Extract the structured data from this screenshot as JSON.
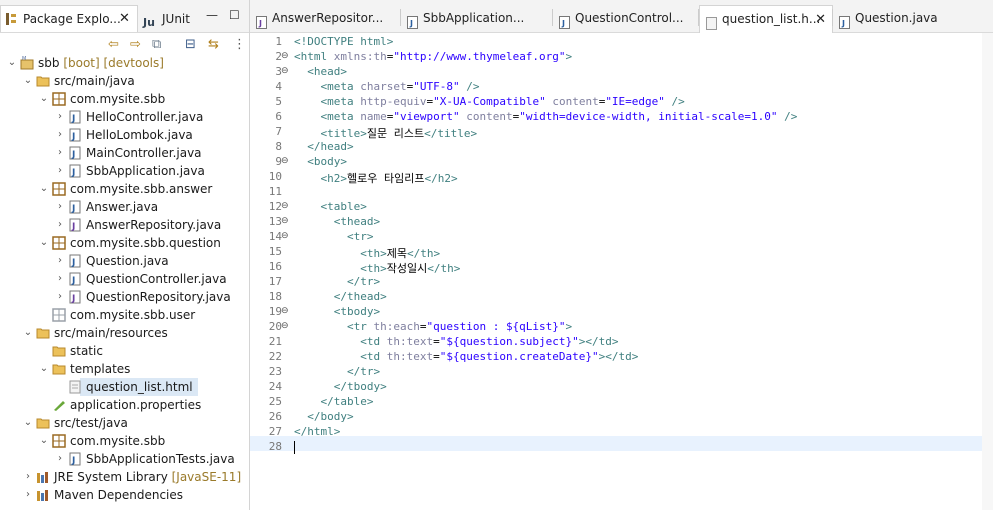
{
  "left_panel": {
    "tabs": [
      {
        "label": "Package Explo...",
        "active": true
      },
      {
        "label": "JUnit",
        "active": false
      }
    ],
    "tree": [
      {
        "label": "sbb",
        "decoration": " [boot] [devtools]",
        "level": 0,
        "expanded": true,
        "icon": "project-icon"
      },
      {
        "label": "src/main/java",
        "level": 1,
        "expanded": true,
        "icon": "source-folder-icon"
      },
      {
        "label": "com.mysite.sbb",
        "level": 2,
        "expanded": true,
        "icon": "package-icon"
      },
      {
        "label": "HelloController.java",
        "level": 3,
        "expanded": false,
        "icon": "java-file-icon"
      },
      {
        "label": "HelloLombok.java",
        "level": 3,
        "expanded": false,
        "icon": "java-file-icon"
      },
      {
        "label": "MainController.java",
        "level": 3,
        "expanded": false,
        "icon": "java-file-icon"
      },
      {
        "label": "SbbApplication.java",
        "level": 3,
        "expanded": false,
        "icon": "java-file-icon"
      },
      {
        "label": "com.mysite.sbb.answer",
        "level": 2,
        "expanded": true,
        "icon": "package-icon"
      },
      {
        "label": "Answer.java",
        "level": 3,
        "expanded": false,
        "icon": "java-file-icon"
      },
      {
        "label": "AnswerRepository.java",
        "level": 3,
        "expanded": false,
        "icon": "java-interface-icon"
      },
      {
        "label": "com.mysite.sbb.question",
        "level": 2,
        "expanded": true,
        "icon": "package-icon"
      },
      {
        "label": "Question.java",
        "level": 3,
        "expanded": false,
        "icon": "java-file-icon"
      },
      {
        "label": "QuestionController.java",
        "level": 3,
        "expanded": false,
        "icon": "java-file-icon"
      },
      {
        "label": "QuestionRepository.java",
        "level": 3,
        "expanded": false,
        "icon": "java-interface-icon"
      },
      {
        "label": "com.mysite.sbb.user",
        "level": 2,
        "expanded": null,
        "icon": "package-empty-icon"
      },
      {
        "label": "src/main/resources",
        "level": 1,
        "expanded": true,
        "icon": "source-folder-icon"
      },
      {
        "label": "static",
        "level": 2,
        "expanded": null,
        "icon": "folder-icon"
      },
      {
        "label": "templates",
        "level": 2,
        "expanded": true,
        "icon": "folder-icon"
      },
      {
        "label": "question_list.html",
        "level": 3,
        "expanded": null,
        "icon": "html-file-icon",
        "selected": true
      },
      {
        "label": "application.properties",
        "level": 2,
        "expanded": null,
        "icon": "properties-file-icon"
      },
      {
        "label": "src/test/java",
        "level": 1,
        "expanded": true,
        "icon": "source-folder-icon"
      },
      {
        "label": "com.mysite.sbb",
        "level": 2,
        "expanded": true,
        "icon": "package-icon"
      },
      {
        "label": "SbbApplicationTests.java",
        "level": 3,
        "expanded": false,
        "icon": "java-file-icon"
      },
      {
        "label": "JRE System Library",
        "decoration": " [JavaSE-11]",
        "level": 1,
        "expanded": false,
        "icon": "library-icon"
      },
      {
        "label": "Maven Dependencies",
        "level": 1,
        "expanded": false,
        "icon": "library-icon"
      }
    ]
  },
  "editor": {
    "tabs": [
      {
        "label": "AnswerRepositor...",
        "icon": "java-interface-icon",
        "active": false
      },
      {
        "label": "SbbApplication...",
        "icon": "java-file-icon",
        "active": false
      },
      {
        "label": "QuestionControl...",
        "icon": "java-file-icon",
        "active": false
      },
      {
        "label": "question_list.h...",
        "icon": "html-file-icon",
        "active": true
      },
      {
        "label": "Question.java",
        "icon": "java-file-icon",
        "active": false
      }
    ],
    "lines": [
      {
        "n": "1",
        "fold": "",
        "parts": [
          [
            "tag",
            "<!DOCTYPE html>"
          ]
        ]
      },
      {
        "n": "2",
        "fold": "⊖",
        "parts": [
          [
            "tag",
            "<html "
          ],
          [
            "an",
            "xmlns:th"
          ],
          [
            "",
            "="
          ],
          [
            "av",
            "\"http://www.thymeleaf.org\""
          ],
          [
            "tag",
            ">"
          ]
        ]
      },
      {
        "n": "3",
        "fold": "⊖",
        "parts": [
          [
            "",
            "  "
          ],
          [
            "tag",
            "<head>"
          ]
        ]
      },
      {
        "n": "4",
        "fold": "",
        "parts": [
          [
            "",
            "    "
          ],
          [
            "tag",
            "<meta "
          ],
          [
            "an",
            "charset"
          ],
          [
            "",
            "="
          ],
          [
            "av",
            "\"UTF-8\""
          ],
          [
            "tag",
            " />"
          ]
        ]
      },
      {
        "n": "5",
        "fold": "",
        "parts": [
          [
            "",
            "    "
          ],
          [
            "tag",
            "<meta "
          ],
          [
            "an",
            "http-equiv"
          ],
          [
            "",
            "="
          ],
          [
            "av",
            "\"X-UA-Compatible\""
          ],
          [
            "",
            " "
          ],
          [
            "an",
            "content"
          ],
          [
            "",
            "="
          ],
          [
            "av",
            "\"IE=edge\""
          ],
          [
            "tag",
            " />"
          ]
        ]
      },
      {
        "n": "6",
        "fold": "",
        "parts": [
          [
            "",
            "    "
          ],
          [
            "tag",
            "<meta "
          ],
          [
            "an",
            "name"
          ],
          [
            "",
            "="
          ],
          [
            "av",
            "\"viewport\""
          ],
          [
            "",
            " "
          ],
          [
            "an",
            "content"
          ],
          [
            "",
            "="
          ],
          [
            "av",
            "\"width=device-width, initial-scale=1.0\""
          ],
          [
            "tag",
            " />"
          ]
        ]
      },
      {
        "n": "7",
        "fold": "",
        "parts": [
          [
            "",
            "    "
          ],
          [
            "tag",
            "<title>"
          ],
          [
            "",
            "질문 리스트"
          ],
          [
            "tag",
            "</title>"
          ]
        ]
      },
      {
        "n": "8",
        "fold": "",
        "parts": [
          [
            "",
            "  "
          ],
          [
            "tag",
            "</head>"
          ]
        ]
      },
      {
        "n": "9",
        "fold": "⊖",
        "parts": [
          [
            "",
            "  "
          ],
          [
            "tag",
            "<body>"
          ]
        ]
      },
      {
        "n": "10",
        "fold": "",
        "parts": [
          [
            "",
            "    "
          ],
          [
            "tag",
            "<h2>"
          ],
          [
            "",
            "헬로우 타임리프"
          ],
          [
            "tag",
            "</h2>"
          ]
        ]
      },
      {
        "n": "11",
        "fold": "",
        "parts": []
      },
      {
        "n": "12",
        "fold": "⊖",
        "parts": [
          [
            "",
            "    "
          ],
          [
            "tag",
            "<table>"
          ]
        ]
      },
      {
        "n": "13",
        "fold": "⊖",
        "parts": [
          [
            "",
            "      "
          ],
          [
            "tag",
            "<thead>"
          ]
        ]
      },
      {
        "n": "14",
        "fold": "⊖",
        "parts": [
          [
            "",
            "        "
          ],
          [
            "tag",
            "<tr>"
          ]
        ]
      },
      {
        "n": "15",
        "fold": "",
        "parts": [
          [
            "",
            "          "
          ],
          [
            "tag",
            "<th>"
          ],
          [
            "",
            "제목"
          ],
          [
            "tag",
            "</th>"
          ]
        ]
      },
      {
        "n": "16",
        "fold": "",
        "parts": [
          [
            "",
            "          "
          ],
          [
            "tag",
            "<th>"
          ],
          [
            "",
            "작성일시"
          ],
          [
            "tag",
            "</th>"
          ]
        ]
      },
      {
        "n": "17",
        "fold": "",
        "parts": [
          [
            "",
            "        "
          ],
          [
            "tag",
            "</tr>"
          ]
        ]
      },
      {
        "n": "18",
        "fold": "",
        "parts": [
          [
            "",
            "      "
          ],
          [
            "tag",
            "</thead>"
          ]
        ]
      },
      {
        "n": "19",
        "fold": "⊖",
        "parts": [
          [
            "",
            "      "
          ],
          [
            "tag",
            "<tbody>"
          ]
        ]
      },
      {
        "n": "20",
        "fold": "⊖",
        "parts": [
          [
            "",
            "        "
          ],
          [
            "tag",
            "<tr "
          ],
          [
            "an",
            "th:each"
          ],
          [
            "",
            "="
          ],
          [
            "av",
            "\"question : ${qList}\""
          ],
          [
            "tag",
            ">"
          ]
        ]
      },
      {
        "n": "21",
        "fold": "",
        "parts": [
          [
            "",
            "          "
          ],
          [
            "tag",
            "<td "
          ],
          [
            "an",
            "th:text"
          ],
          [
            "",
            "="
          ],
          [
            "av",
            "\"${question.subject}\""
          ],
          [
            "tag",
            "></td>"
          ]
        ]
      },
      {
        "n": "22",
        "fold": "",
        "parts": [
          [
            "",
            "          "
          ],
          [
            "tag",
            "<td "
          ],
          [
            "an",
            "th:text"
          ],
          [
            "",
            "="
          ],
          [
            "av",
            "\"${question.createDate}\""
          ],
          [
            "tag",
            "></td>"
          ]
        ]
      },
      {
        "n": "23",
        "fold": "",
        "parts": [
          [
            "",
            "        "
          ],
          [
            "tag",
            "</tr>"
          ]
        ]
      },
      {
        "n": "24",
        "fold": "",
        "parts": [
          [
            "",
            "      "
          ],
          [
            "tag",
            "</tbody>"
          ]
        ]
      },
      {
        "n": "25",
        "fold": "",
        "parts": [
          [
            "",
            "    "
          ],
          [
            "tag",
            "</table>"
          ]
        ]
      },
      {
        "n": "26",
        "fold": "",
        "parts": [
          [
            "",
            "  "
          ],
          [
            "tag",
            "</body>"
          ]
        ]
      },
      {
        "n": "27",
        "fold": "",
        "parts": [
          [
            "tag",
            "</html>"
          ]
        ]
      },
      {
        "n": "28",
        "fold": "",
        "parts": []
      }
    ]
  },
  "colors": {
    "tag": "#3f7f7f",
    "attr_name": "#7f7f9f",
    "attr_value": "#2a00ff",
    "selection": "#dbe8f5",
    "current_line": "#e8f2fe"
  }
}
